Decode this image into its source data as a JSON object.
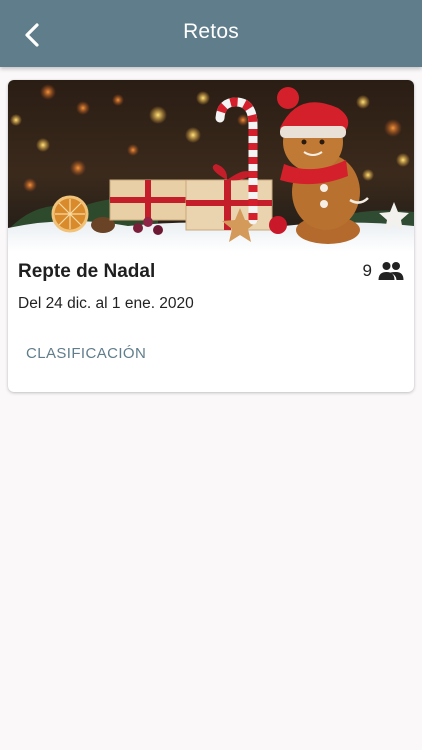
{
  "header": {
    "title": "Retos",
    "back_icon": "chevron-left-icon",
    "background_color": "#607d8b"
  },
  "challenge": {
    "title": "Repte de Nadal",
    "participants_count": "9",
    "participants_icon": "people-icon",
    "dates": "Del 24 dic. al 1 ene. 2020",
    "action_label": "CLASIFICACIÓN",
    "action_color": "#607d8b"
  }
}
